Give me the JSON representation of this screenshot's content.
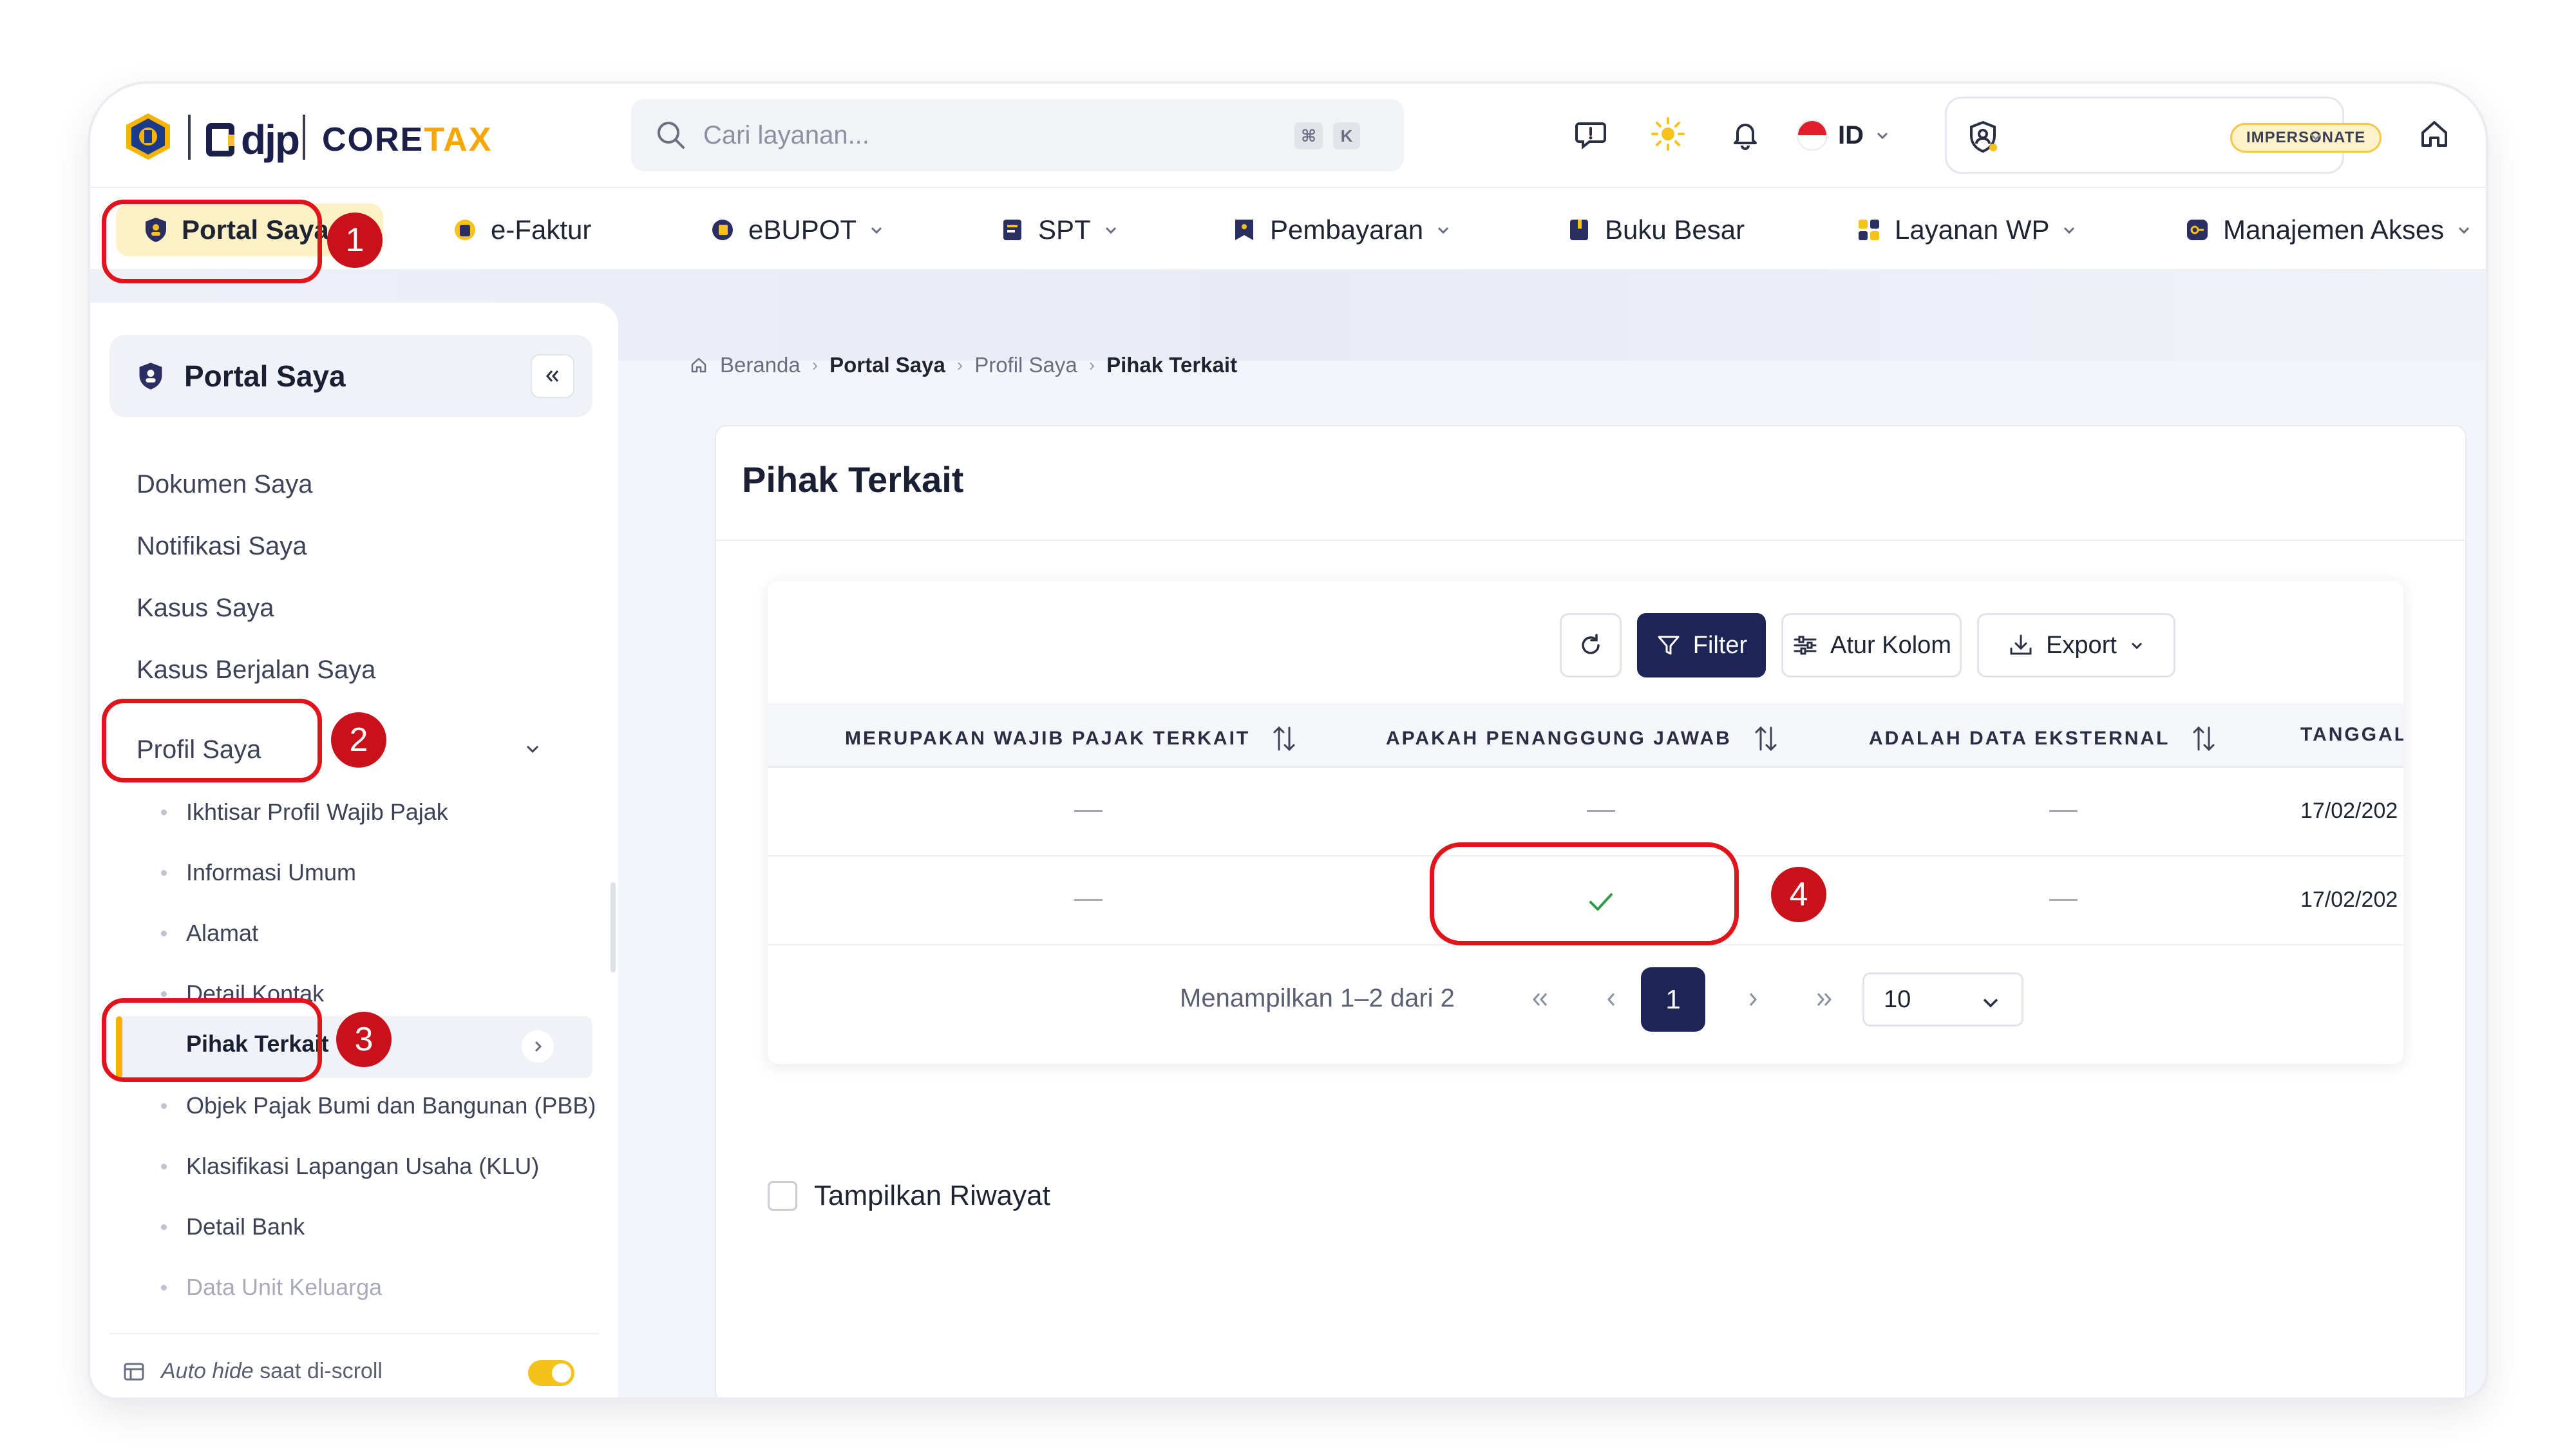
{
  "header": {
    "brand_djp": "djp",
    "brand_core": "CORE",
    "brand_tax": "TAX",
    "search_placeholder": "Cari layanan...",
    "search_kbd_1": "⌘",
    "search_kbd_2": "K",
    "language": "ID",
    "impersonate_label": "IMPERSONATE"
  },
  "nav": {
    "portal_saya": "Portal Saya",
    "e_faktur": "e-Faktur",
    "ebupot": "eBUPOT",
    "spt": "SPT",
    "pembayaran": "Pembayaran",
    "buku_besar": "Buku Besar",
    "layanan_wp": "Layanan WP",
    "manajemen_akses": "Manajemen Akses"
  },
  "sidebar": {
    "title": "Portal Saya",
    "items": [
      "Dokumen Saya",
      "Notifikasi Saya",
      "Kasus Saya",
      "Kasus Berjalan Saya",
      "Profil Saya"
    ],
    "profil_sub": [
      "Ikhtisar Profil Wajib Pajak",
      "Informasi Umum",
      "Alamat",
      "Detail Kontak",
      "Pihak Terkait",
      "Objek Pajak Bumi dan Bangunan (PBB)",
      "Klasifikasi Lapangan Usaha (KLU)",
      "Detail Bank",
      "Data Unit Keluarga"
    ],
    "auto_hide_em": "Auto hide",
    "auto_hide_rest": " saat di-scroll",
    "auto_hide_on": true
  },
  "breadcrumb": [
    "Beranda",
    "Portal Saya",
    "Profil Saya",
    "Pihak Terkait"
  ],
  "page": {
    "title": "Pihak Terkait",
    "toolbar": {
      "filter": "Filter",
      "columns": "Atur Kolom",
      "export": "Export"
    },
    "columns": [
      "MERUPAKAN WAJIB PAJAK TERKAIT",
      "APAKAH PENANGGUNG JAWAB",
      "ADALAH DATA EKSTERNAL",
      "TANGGAL"
    ],
    "rows": [
      {
        "wajib_pajak_terkait": "—",
        "penanggung_jawab": "—",
        "data_eksternal": "—",
        "tanggal": "17/02/202"
      },
      {
        "wajib_pajak_terkait": "—",
        "penanggung_jawab": "check",
        "data_eksternal": "—",
        "tanggal": "17/02/202"
      }
    ],
    "pagination": {
      "summary": "Menampilkan 1–2 dari 2",
      "current_page": "1",
      "page_size": "10"
    },
    "history_label": "Tampilkan Riwayat"
  },
  "annotations": [
    "1",
    "2",
    "3",
    "4"
  ],
  "colors": {
    "accent_yellow": "#f6b400",
    "primary_navy": "#1c2556",
    "annotation_red": "#e0141a",
    "check_green": "#2e9a4a"
  }
}
